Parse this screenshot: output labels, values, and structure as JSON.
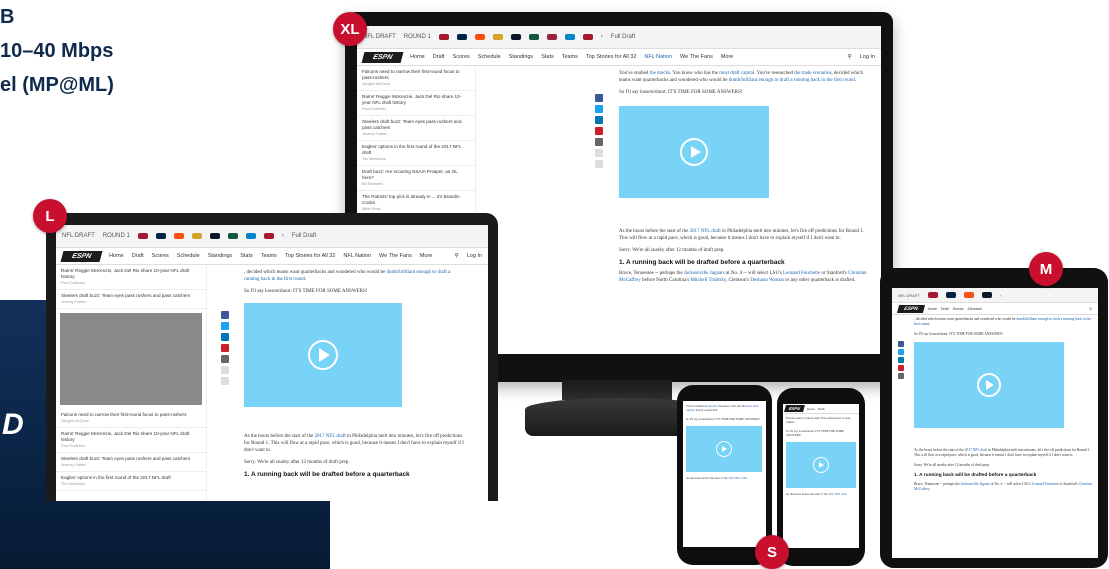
{
  "heading": {
    "line1": "B",
    "line2": "10–40 Mbps",
    "line3": "el (MP@ML)"
  },
  "brand_letter": "D",
  "badges": {
    "xl": "XL",
    "l": "L",
    "m": "M",
    "s": "S"
  },
  "site": {
    "logo": "ESPN",
    "teams_bar": {
      "draft_label": "NFL DRAFT",
      "round_label": "ROUND 1",
      "more_label": "Full Draft"
    },
    "nav": [
      "Home",
      "Draft",
      "Scores",
      "Schedule",
      "Standings",
      "Stats",
      "Teams",
      "Top Stories for All 32",
      "NFL Nation",
      "We The Fans",
      "More"
    ],
    "search_label": "Log In",
    "sidebar_items": [
      {
        "title": "Falcons need to narrow their first-round focus to pass-rushers",
        "meta": "Vaughn McClure"
      },
      {
        "title": "Rams' Reggie McKenzie, Jack Del Rio share 10-year NFL draft history",
        "meta": "Paul Gutierrez"
      },
      {
        "title": "Steelers draft buzz: Team eyes pass rushers and pass catchers",
        "meta": "Jeremy Fowler"
      },
      {
        "title": "Eagles' options in the first round of the 2017 NFL draft",
        "meta": "Tim McManus"
      },
      {
        "title": "Draft buzz: Are scouting NSAIA Prosper, an OL here?",
        "meta": "Bill Barnwell"
      },
      {
        "title": "The Patriots' top pick is already in ... it's Brandin Cooks",
        "meta": "Mike Reiss"
      }
    ],
    "article": {
      "p1_a": "You've studied",
      "p1_link1": "the mocks",
      "p1_b": ". You know who has the",
      "p1_link2": "most draft capital",
      "p1_c": ". You've researched",
      "p1_link3": "the trade scenarios",
      "p1_d": ", decided which teams want quarterbacks and wondered who would be",
      "p1_link4": "dumb/brilliant enough to draft a running back in the first round",
      "p2": "So I'll say loosen/shout: IT'S TIME FOR SOME ANSWERS!",
      "p3_a": "As the hours before the start of the",
      "p3_link": "2017 NFL draft",
      "p3_b": "in Philadelphia melt into minutes, let's fire off predictions for Round 1. This will flow at a rapid pace, which is good, because it means I don't have to explain myself if I don't want to.",
      "p4": "Sorry. We're all snarky after 12 months of draft prep.",
      "h1": "1. A running back will be drafted before a quarterback",
      "p5_a": "Bruce, Tennessee -- perhaps the",
      "p5_link1": "Jacksonville Jaguars",
      "p5_b": "at No. 4 -- will select LSU's",
      "p5_link2": "Leonard Fournette",
      "p5_c": "or Stanford's",
      "p5_link3": "Christian McCaffrey",
      "p5_d": "before North Carolina's",
      "p5_link4": "Mitchell Trubisky",
      "p5_e": ", Clemson's",
      "p5_link5": "Deshaun Watson",
      "p5_f": "or any other quarterback is drafted."
    }
  },
  "colors": {
    "accent_red": "#c8102e",
    "video_blue": "#79d3f6",
    "link_blue": "#1a63b0",
    "navy_bg": "#0a2445",
    "facebook": "#3b5998",
    "twitter": "#1da1f2",
    "linkedin": "#0077b5",
    "pinterest": "#cb2027",
    "email": "#666666"
  },
  "icons": [
    "play-icon",
    "search-icon",
    "facebook-icon",
    "twitter-icon",
    "linkedin-icon",
    "pinterest-icon",
    "email-icon",
    "print-icon",
    "comment-icon",
    "chevron-right-icon"
  ]
}
